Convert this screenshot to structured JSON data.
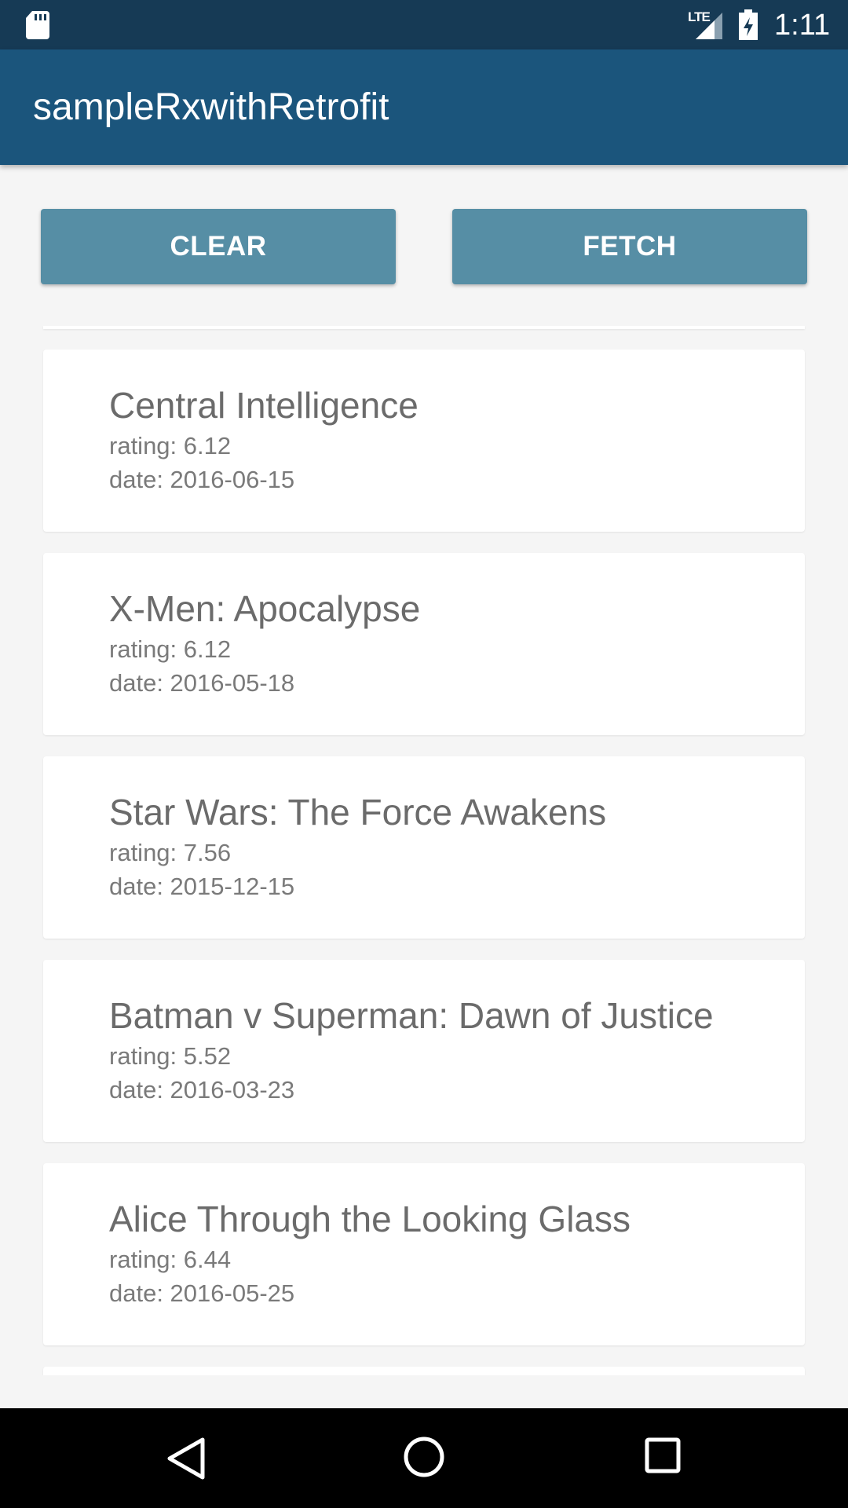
{
  "status_bar": {
    "network": "LTE",
    "time": "1:11",
    "icons": [
      "sd-card-icon",
      "signal-icon",
      "battery-charging-icon"
    ]
  },
  "app_bar": {
    "title": "sampleRxwithRetrofit",
    "color": "#1b557c"
  },
  "actions": {
    "clear_label": "CLEAR",
    "fetch_label": "FETCH",
    "button_color": "#568ea5"
  },
  "movies": [
    {
      "title": "Central Intelligence",
      "rating": "rating: 6.12",
      "date": "date: 2016-06-15"
    },
    {
      "title": "X-Men: Apocalypse",
      "rating": "rating: 6.12",
      "date": "date: 2016-05-18"
    },
    {
      "title": "Star Wars: The Force Awakens",
      "rating": "rating: 7.56",
      "date": "date: 2015-12-15"
    },
    {
      "title": "Batman v Superman: Dawn of Justice",
      "rating": "rating: 5.52",
      "date": "date: 2016-03-23"
    },
    {
      "title": "Alice Through the Looking Glass",
      "rating": "rating: 6.44",
      "date": "date: 2016-05-25"
    }
  ],
  "nav_bar": {
    "icons": [
      "back-icon",
      "home-icon",
      "recents-icon"
    ]
  }
}
